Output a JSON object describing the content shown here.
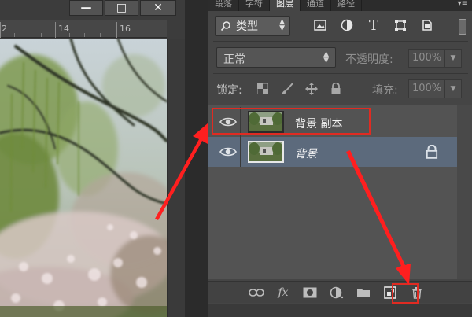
{
  "document": {
    "window_controls": {
      "minimize": "—",
      "maximize": "□",
      "close": "✕"
    },
    "ruler_labels": [
      "2",
      "14",
      "16"
    ]
  },
  "panel": {
    "tabs": [
      {
        "label": "段落",
        "active": false
      },
      {
        "label": "字符",
        "active": false
      },
      {
        "label": "图层",
        "active": true
      },
      {
        "label": "通道",
        "active": false
      },
      {
        "label": "路径",
        "active": false
      }
    ],
    "tab_menu": "▾≡",
    "filter": {
      "label": "类型",
      "icon": "search-icon"
    },
    "filter_icons": [
      "image-filter-icon",
      "adjustment-filter-icon",
      "type-filter-icon",
      "shape-filter-icon",
      "smart-object-filter-icon"
    ],
    "type_icon_glyph": "T",
    "blend_mode": "正常",
    "opacity_label": "不透明度:",
    "opacity_value": "100%",
    "lock_label": "锁定:",
    "fill_label": "填充:",
    "fill_value": "100%",
    "layers": [
      {
        "name": "背景 副本",
        "visible": true,
        "selected": false,
        "locked": false
      },
      {
        "name": "背景",
        "visible": true,
        "selected": true,
        "locked": true
      }
    ],
    "bottom_icons": [
      "link-icon",
      "fx-icon",
      "mask-icon",
      "adjustment-icon",
      "folder-icon",
      "new-layer-icon",
      "trash-icon"
    ],
    "fx_label": "fx"
  },
  "colors": {
    "panel_bg": "#454545",
    "selected_layer": "#5c6a7c",
    "annotation_red": "#e02b22"
  }
}
